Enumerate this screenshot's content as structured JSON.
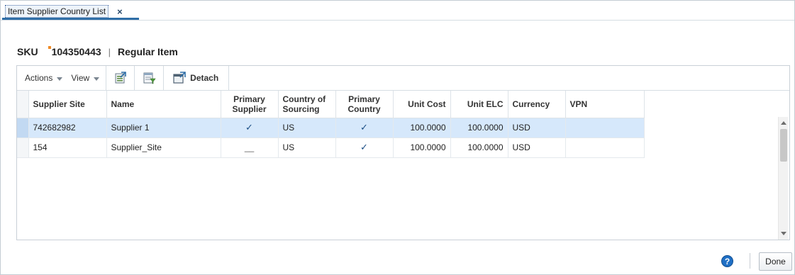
{
  "tab": {
    "label": "Item Supplier Country List",
    "close": "×"
  },
  "header": {
    "sku_label": "SKU",
    "sku_value": "104350443",
    "separator": "|",
    "item_type": "Regular Item"
  },
  "toolbar": {
    "actions_label": "Actions",
    "view_label": "View",
    "detach_label": "Detach"
  },
  "table": {
    "columns": {
      "supplier_site": "Supplier Site",
      "name": "Name",
      "primary_supplier": "Primary Supplier",
      "country_of_sourcing": "Country of Sourcing",
      "primary_country": "Primary Country",
      "unit_cost": "Unit Cost",
      "unit_elc": "Unit ELC",
      "currency": "Currency",
      "vpn": "VPN"
    },
    "rows": [
      {
        "supplier_site": "742682982",
        "name": "Supplier 1",
        "primary_supplier": "✓",
        "country_of_sourcing": "US",
        "primary_country": "✓",
        "unit_cost": "100.0000",
        "unit_elc": "100.0000",
        "currency": "USD",
        "vpn": "",
        "selected": true
      },
      {
        "supplier_site": "154",
        "name": "Supplier_Site",
        "primary_supplier": "__",
        "country_of_sourcing": "US",
        "primary_country": "✓",
        "unit_cost": "100.0000",
        "unit_elc": "100.0000",
        "currency": "USD",
        "vpn": "",
        "selected": false
      }
    ]
  },
  "footer": {
    "help": "?",
    "done_label": "Done"
  },
  "icons": {
    "tab_close": "close-icon",
    "export": "export-to-excel-icon",
    "query": "query-by-example-icon",
    "detach": "detach-icon",
    "help": "help-icon"
  },
  "colors": {
    "accent": "#2f6ea7",
    "selected_row": "#d6e8fb",
    "help_button": "#1f6fc5",
    "changed_indicator": "#f08a24"
  }
}
